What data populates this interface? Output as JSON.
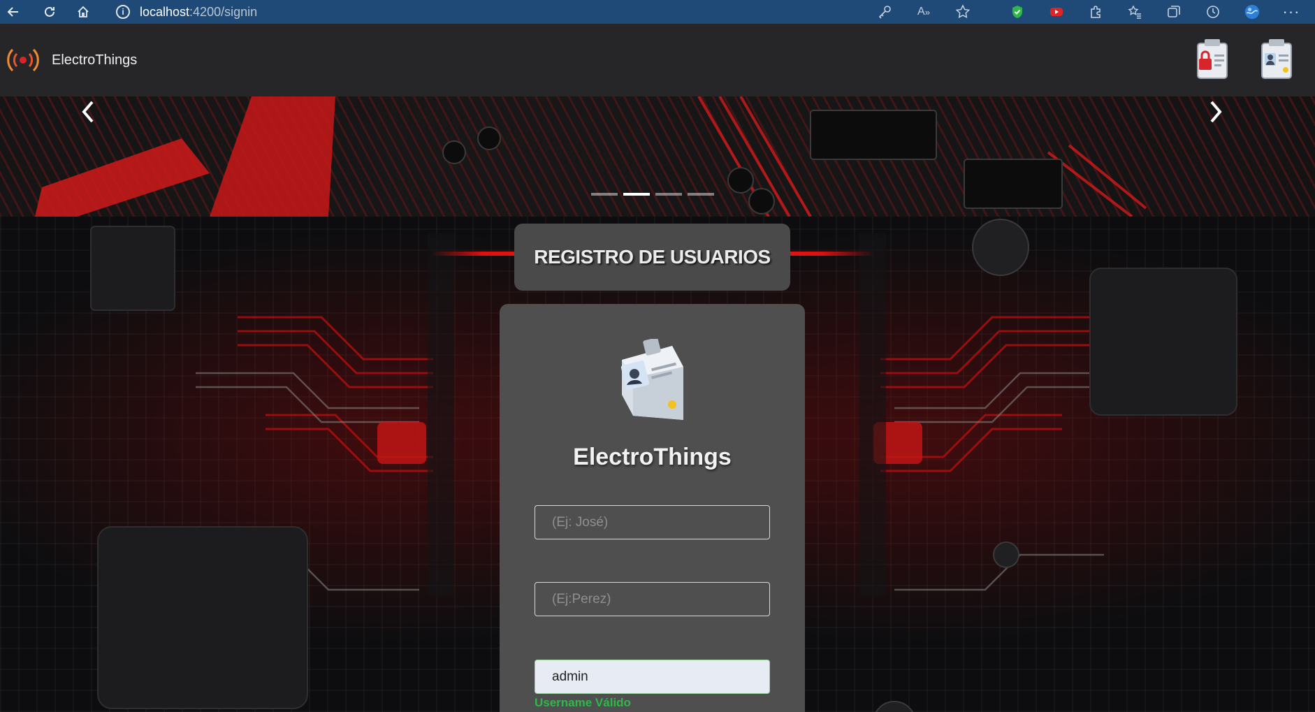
{
  "browser": {
    "url_host": "localhost",
    "url_path": ":4200/signin"
  },
  "navbar": {
    "brand_name": "ElectroThings",
    "actions": [
      "login-badge-icon",
      "signup-badge-icon"
    ]
  },
  "carousel": {
    "indicator_count": 4,
    "active_index": 1
  },
  "registration": {
    "banner_title": "REGISTRO DE USUARIOS",
    "card_title": "ElectroThings",
    "first_name": {
      "placeholder": "(Ej: José)",
      "value": ""
    },
    "last_name": {
      "placeholder": "(Ej:Perez)",
      "value": ""
    },
    "username": {
      "value": "admin",
      "validation_message": "Username Válido"
    }
  },
  "colors": {
    "accent_red": "#e02020",
    "valid_green": "#2fb84a",
    "browser_bar": "#1f4a78"
  }
}
